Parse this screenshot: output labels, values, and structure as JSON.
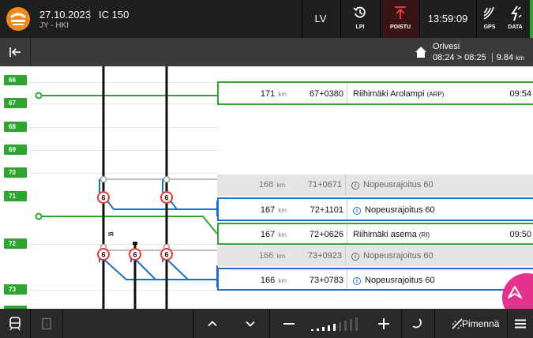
{
  "header": {
    "date": "27.10.2023",
    "route": "JY - HKI",
    "train": "IC 150",
    "lv_label": "LV",
    "lpi_label": "LPI",
    "poistu_label": "POISTU",
    "clock": "13:59:09",
    "gps_label": "GPS",
    "data_label": "DATA"
  },
  "next_station": {
    "name": "Orivesi",
    "arrival": "08:24",
    "arrow": ">",
    "departure": "08:25",
    "distance": "9.84",
    "distance_unit": "km"
  },
  "km_markers": [
    "66",
    "67",
    "68",
    "69",
    "70",
    "71",
    "72",
    "73"
  ],
  "events": [
    {
      "distance": "171",
      "unit": "km",
      "position": "67+0380",
      "name": "Riihimäki Arolampi",
      "code": "(ARP)",
      "time": "09:54",
      "style": "green"
    },
    {
      "distance": "168",
      "unit": "km",
      "position": "71+0671",
      "name": "Nopeusrajoitus 60",
      "code": "",
      "time": "",
      "style": "gray"
    },
    {
      "distance": "167",
      "unit": "km",
      "position": "72+1101",
      "name": "Nopeusrajoitus 60",
      "code": "",
      "time": "",
      "style": "blue"
    },
    {
      "distance": "167",
      "unit": "km",
      "position": "72+0626",
      "name": "Riihimäki asema",
      "code": "(RI)",
      "time": "09:50",
      "style": "green"
    },
    {
      "distance": "166",
      "unit": "km",
      "position": "73+0923",
      "name": "Nopeusrajoitus 60",
      "code": "",
      "time": "",
      "style": "gray"
    },
    {
      "distance": "166",
      "unit": "km",
      "position": "73+0783",
      "name": "Nopeusrajoitus 60",
      "code": "",
      "time": "",
      "style": "blue"
    }
  ],
  "speed_sign_value": "6",
  "track_label": "IR",
  "info_glyph": "i",
  "footer": {
    "dim_label": "Pimennä"
  },
  "colors": {
    "topbar": "#1f1f1f",
    "accent_orange": "#f08a1c",
    "green": "#2ea530",
    "blue": "#1d6fc8",
    "fab": "#e6318f",
    "alert_red": "#e53935"
  },
  "icons": [
    "logo-icon",
    "history-icon",
    "exit-icon",
    "gps-icon",
    "data-icon",
    "collapse-icon",
    "home-icon",
    "info-icon",
    "train-icon",
    "document-icon",
    "chevron-up-icon",
    "chevron-down-icon",
    "minus-icon",
    "brightness-bars-icon",
    "plus-icon",
    "night-mode-icon",
    "dim-icon",
    "menu-icon",
    "navigation-icon"
  ]
}
